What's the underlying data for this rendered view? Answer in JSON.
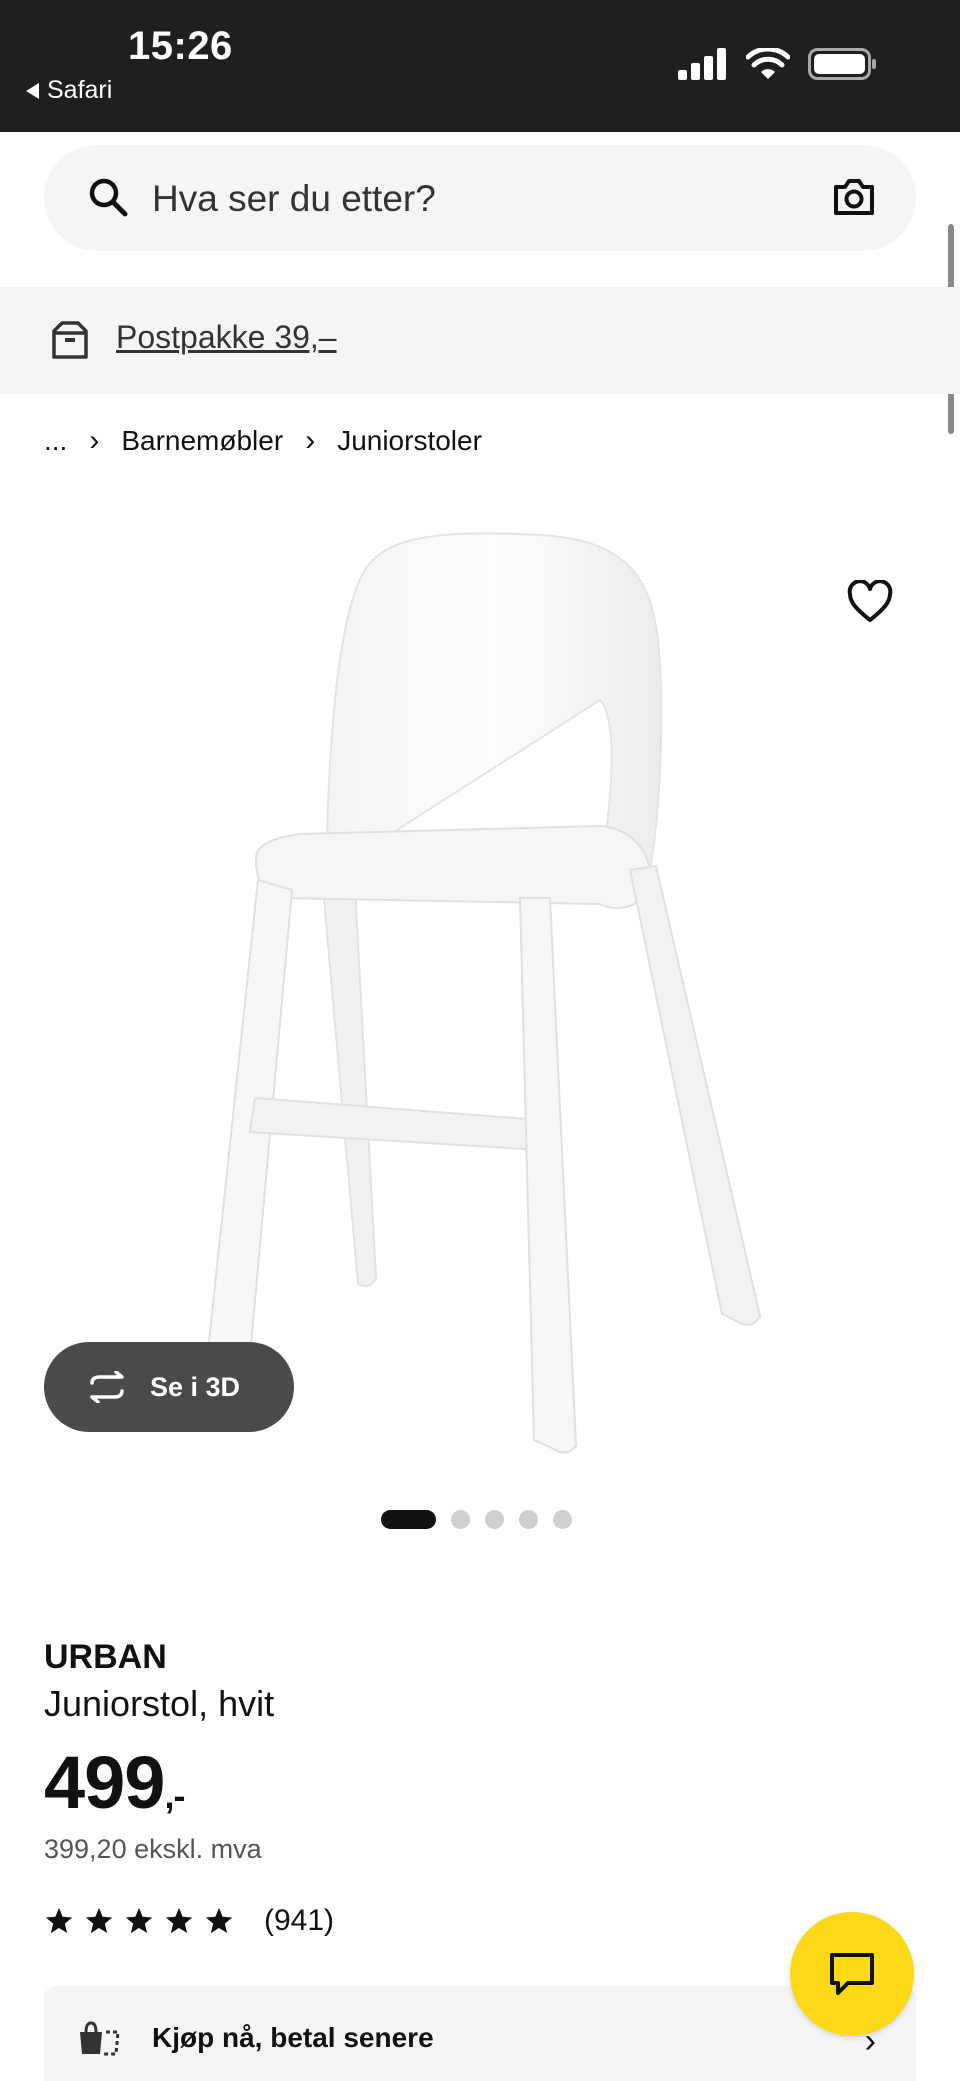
{
  "status_bar": {
    "time": "15:26",
    "back_app": "Safari",
    "icons": [
      "cellular-signal-icon",
      "wifi-icon",
      "battery-icon"
    ]
  },
  "search": {
    "placeholder": "Hva ser du etter?",
    "icon": "search-icon",
    "camera_icon": "camera-icon"
  },
  "banner": {
    "icon": "parcel-box-icon",
    "link_text": "Postpakke 39,–"
  },
  "breadcrumb": {
    "ellipsis": "...",
    "items": [
      "Barnemøbler",
      "Juniorstoler"
    ],
    "separator": "›"
  },
  "product": {
    "image_icons": [
      "heart-icon"
    ],
    "view_3d_label": "Se i 3D",
    "carousel": {
      "total": 5,
      "active_index": 0
    },
    "brand": "URBAN",
    "description": "Juniorstol, hvit",
    "price": "499",
    "price_suffix": ",-",
    "price_ex_vat": "399,20 ekskl. mva",
    "rating": {
      "stars": 5,
      "count": "(941)"
    }
  },
  "buy_now": {
    "label": "Kjøp nå, betal senere",
    "icon": "pay-later-icon"
  },
  "chat": {
    "icon": "chat-icon"
  },
  "colors": {
    "status_bg": "#1f1f1f",
    "field_bg": "#f5f5f5",
    "chat_yellow": "#fbd914",
    "button_dark": "#4a4a4a"
  }
}
